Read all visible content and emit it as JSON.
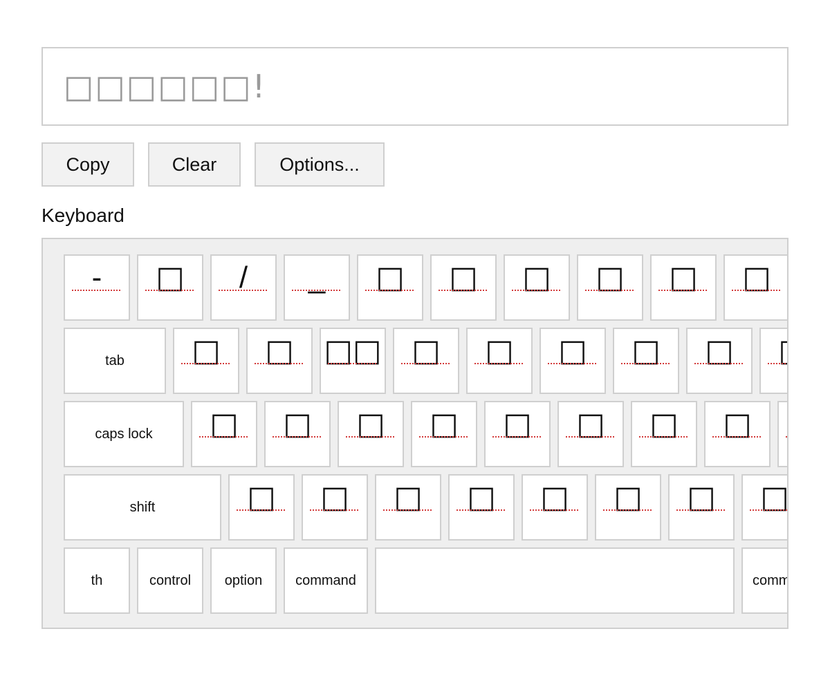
{
  "editor": {
    "text": "□□□□□□!"
  },
  "toolbar": {
    "copy_label": "Copy",
    "clear_label": "Clear",
    "options_label": "Options..."
  },
  "keyboard": {
    "title": "Keyboard",
    "row1": [
      "-",
      "□",
      "/",
      "_",
      "□",
      "□",
      "□",
      "□",
      "□",
      "□"
    ],
    "row2": {
      "tab_label": "tab",
      "keys": [
        "□",
        "□",
        "□□",
        "□",
        "□",
        "□",
        "□",
        "□",
        "□"
      ]
    },
    "row3": {
      "caps_label": "caps lock",
      "keys": [
        "□",
        "□",
        "□",
        "□",
        "□",
        "□",
        "□",
        "□",
        ""
      ]
    },
    "row4": {
      "shift_label": "shift",
      "keys": [
        "□",
        "□",
        "□",
        "□",
        "□",
        "□",
        "□",
        "□"
      ]
    },
    "row5": {
      "fn_label": "th",
      "control_label": "control",
      "option_label": "option",
      "command_label": "command",
      "space_label": "",
      "command_right_label": "comm"
    }
  }
}
